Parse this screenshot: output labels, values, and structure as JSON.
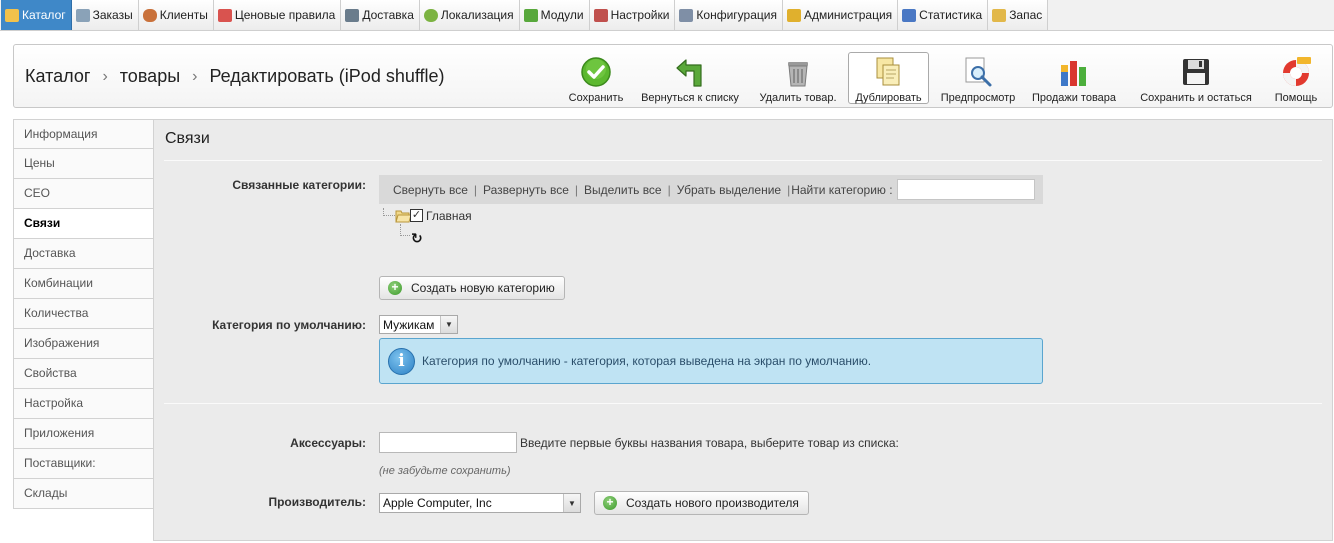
{
  "topnav": [
    {
      "label": "Каталог",
      "icon": "folder-icon",
      "color": "#f3c24b",
      "active": true
    },
    {
      "label": "Заказы",
      "icon": "cart-icon",
      "color": "#8aa2b8"
    },
    {
      "label": "Клиенты",
      "icon": "user-icon",
      "color": "#c9713b"
    },
    {
      "label": "Ценовые правила",
      "icon": "price-rules-icon",
      "color": "#d9534f"
    },
    {
      "label": "Доставка",
      "icon": "truck-icon",
      "color": "#6a7c8c"
    },
    {
      "label": "Локализация",
      "icon": "globe-icon",
      "color": "#7cb342"
    },
    {
      "label": "Модули",
      "icon": "puzzle-icon",
      "color": "#58a83c"
    },
    {
      "label": "Настройки",
      "icon": "settings-window-icon",
      "color": "#c0504d"
    },
    {
      "label": "Конфигурация",
      "icon": "wrench-icon",
      "color": "#7f8fa6"
    },
    {
      "label": "Администрация",
      "icon": "key-icon",
      "color": "#e0b02d"
    },
    {
      "label": "Статистика",
      "icon": "stats-icon",
      "color": "#4a78c4"
    },
    {
      "label": "Запас",
      "icon": "stock-icon",
      "color": "#e2b84a"
    }
  ],
  "breadcrumb": {
    "part1": "Каталог",
    "part2": "товары",
    "part3": "Редактировать (iPod shuffle)",
    "sep": "›"
  },
  "toolbar": [
    {
      "label": "Сохранить",
      "icon": "save-check-icon",
      "name": "save"
    },
    {
      "label": "Вернуться к списку",
      "icon": "back-arrow-icon",
      "name": "back-to-list"
    },
    {
      "label": "Удалить товар.",
      "icon": "trash-icon",
      "name": "delete-product"
    },
    {
      "label": "Дублировать",
      "icon": "duplicate-icon",
      "name": "duplicate",
      "active": true
    },
    {
      "label": "Предпросмотр",
      "icon": "preview-icon",
      "name": "preview"
    },
    {
      "label": "Продажи товара",
      "icon": "sales-chart-icon",
      "name": "product-sales"
    },
    {
      "label": "Сохранить и остаться",
      "icon": "floppy-icon",
      "name": "save-and-stay"
    },
    {
      "label": "Помощь",
      "icon": "help-lifebuoy-icon",
      "name": "help"
    }
  ],
  "tabs": [
    "Информация",
    "Цены",
    "СЕО",
    "Связи",
    "Доставка",
    "Комбинации",
    "Количества",
    "Изображения",
    "Свойства",
    "Настройка",
    "Приложения",
    "Поставщики:",
    "Склады"
  ],
  "active_tab": "Связи",
  "section": {
    "title": "Связи",
    "related_categories_label": "Связанные категории:",
    "tree_actions": {
      "collapse_all": "Свернуть все",
      "expand_all": "Развернуть все",
      "select_all": "Выделить все",
      "unselect": "Убрать выделение",
      "find_category": "Найти категорию :"
    },
    "tree_root": "Главная",
    "create_category_button": "Создать новую категорию",
    "default_category_label": "Категория по умолчанию:",
    "default_category_value": "Мужикам",
    "info_text": "Категория по умолчанию - категория, которая выведена на экран по умолчанию.",
    "accessories_label": "Аксессуары:",
    "accessories_hint": "Введите первые буквы названия товара, выберите товар из списка:",
    "save_reminder": "(не забудьте сохранить)",
    "manufacturer_label": "Производитель:",
    "manufacturer_value": "Apple Computer, Inc",
    "create_manufacturer_button": "Создать нового производителя"
  }
}
